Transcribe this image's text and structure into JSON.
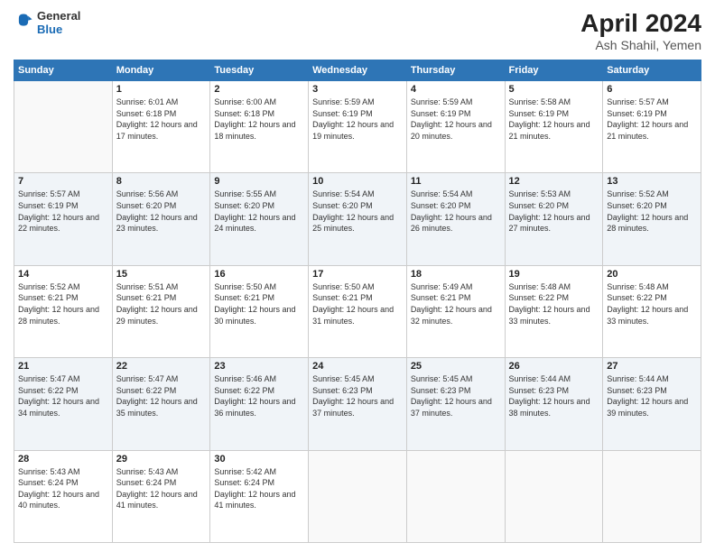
{
  "header": {
    "logo_general": "General",
    "logo_blue": "Blue",
    "main_title": "April 2024",
    "subtitle": "Ash Shahil, Yemen"
  },
  "columns": [
    "Sunday",
    "Monday",
    "Tuesday",
    "Wednesday",
    "Thursday",
    "Friday",
    "Saturday"
  ],
  "weeks": [
    [
      {
        "day": "",
        "sunrise": "",
        "sunset": "",
        "daylight": ""
      },
      {
        "day": "1",
        "sunrise": "6:01 AM",
        "sunset": "6:18 PM",
        "daylight": "12 hours and 17 minutes."
      },
      {
        "day": "2",
        "sunrise": "6:00 AM",
        "sunset": "6:18 PM",
        "daylight": "12 hours and 18 minutes."
      },
      {
        "day": "3",
        "sunrise": "5:59 AM",
        "sunset": "6:19 PM",
        "daylight": "12 hours and 19 minutes."
      },
      {
        "day": "4",
        "sunrise": "5:59 AM",
        "sunset": "6:19 PM",
        "daylight": "12 hours and 20 minutes."
      },
      {
        "day": "5",
        "sunrise": "5:58 AM",
        "sunset": "6:19 PM",
        "daylight": "12 hours and 21 minutes."
      },
      {
        "day": "6",
        "sunrise": "5:57 AM",
        "sunset": "6:19 PM",
        "daylight": "12 hours and 21 minutes."
      }
    ],
    [
      {
        "day": "7",
        "sunrise": "5:57 AM",
        "sunset": "6:19 PM",
        "daylight": "12 hours and 22 minutes."
      },
      {
        "day": "8",
        "sunrise": "5:56 AM",
        "sunset": "6:20 PM",
        "daylight": "12 hours and 23 minutes."
      },
      {
        "day": "9",
        "sunrise": "5:55 AM",
        "sunset": "6:20 PM",
        "daylight": "12 hours and 24 minutes."
      },
      {
        "day": "10",
        "sunrise": "5:54 AM",
        "sunset": "6:20 PM",
        "daylight": "12 hours and 25 minutes."
      },
      {
        "day": "11",
        "sunrise": "5:54 AM",
        "sunset": "6:20 PM",
        "daylight": "12 hours and 26 minutes."
      },
      {
        "day": "12",
        "sunrise": "5:53 AM",
        "sunset": "6:20 PM",
        "daylight": "12 hours and 27 minutes."
      },
      {
        "day": "13",
        "sunrise": "5:52 AM",
        "sunset": "6:20 PM",
        "daylight": "12 hours and 28 minutes."
      }
    ],
    [
      {
        "day": "14",
        "sunrise": "5:52 AM",
        "sunset": "6:21 PM",
        "daylight": "12 hours and 28 minutes."
      },
      {
        "day": "15",
        "sunrise": "5:51 AM",
        "sunset": "6:21 PM",
        "daylight": "12 hours and 29 minutes."
      },
      {
        "day": "16",
        "sunrise": "5:50 AM",
        "sunset": "6:21 PM",
        "daylight": "12 hours and 30 minutes."
      },
      {
        "day": "17",
        "sunrise": "5:50 AM",
        "sunset": "6:21 PM",
        "daylight": "12 hours and 31 minutes."
      },
      {
        "day": "18",
        "sunrise": "5:49 AM",
        "sunset": "6:21 PM",
        "daylight": "12 hours and 32 minutes."
      },
      {
        "day": "19",
        "sunrise": "5:48 AM",
        "sunset": "6:22 PM",
        "daylight": "12 hours and 33 minutes."
      },
      {
        "day": "20",
        "sunrise": "5:48 AM",
        "sunset": "6:22 PM",
        "daylight": "12 hours and 33 minutes."
      }
    ],
    [
      {
        "day": "21",
        "sunrise": "5:47 AM",
        "sunset": "6:22 PM",
        "daylight": "12 hours and 34 minutes."
      },
      {
        "day": "22",
        "sunrise": "5:47 AM",
        "sunset": "6:22 PM",
        "daylight": "12 hours and 35 minutes."
      },
      {
        "day": "23",
        "sunrise": "5:46 AM",
        "sunset": "6:22 PM",
        "daylight": "12 hours and 36 minutes."
      },
      {
        "day": "24",
        "sunrise": "5:45 AM",
        "sunset": "6:23 PM",
        "daylight": "12 hours and 37 minutes."
      },
      {
        "day": "25",
        "sunrise": "5:45 AM",
        "sunset": "6:23 PM",
        "daylight": "12 hours and 37 minutes."
      },
      {
        "day": "26",
        "sunrise": "5:44 AM",
        "sunset": "6:23 PM",
        "daylight": "12 hours and 38 minutes."
      },
      {
        "day": "27",
        "sunrise": "5:44 AM",
        "sunset": "6:23 PM",
        "daylight": "12 hours and 39 minutes."
      }
    ],
    [
      {
        "day": "28",
        "sunrise": "5:43 AM",
        "sunset": "6:24 PM",
        "daylight": "12 hours and 40 minutes."
      },
      {
        "day": "29",
        "sunrise": "5:43 AM",
        "sunset": "6:24 PM",
        "daylight": "12 hours and 41 minutes."
      },
      {
        "day": "30",
        "sunrise": "5:42 AM",
        "sunset": "6:24 PM",
        "daylight": "12 hours and 41 minutes."
      },
      {
        "day": "",
        "sunrise": "",
        "sunset": "",
        "daylight": ""
      },
      {
        "day": "",
        "sunrise": "",
        "sunset": "",
        "daylight": ""
      },
      {
        "day": "",
        "sunrise": "",
        "sunset": "",
        "daylight": ""
      },
      {
        "day": "",
        "sunrise": "",
        "sunset": "",
        "daylight": ""
      }
    ]
  ]
}
